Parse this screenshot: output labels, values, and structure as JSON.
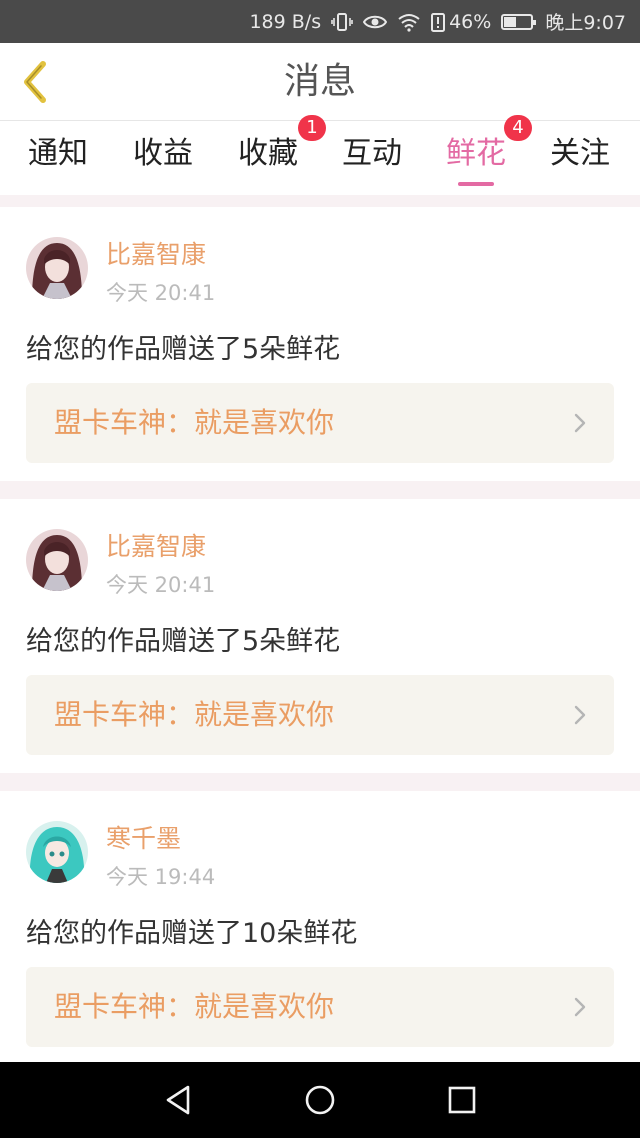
{
  "status_bar": {
    "speed": "189 B/s",
    "battery_text": "46%",
    "battery_level": 0.46,
    "time": "晚上9:07",
    "icons": [
      "vibrate-icon",
      "eye-icon",
      "wifi-icon",
      "battery-alert-icon",
      "battery-icon"
    ]
  },
  "header": {
    "title": "消息",
    "back_icon": "chevron-left-icon",
    "accent_color": "#e36aa3"
  },
  "tabs": [
    {
      "label": "通知",
      "badge": ""
    },
    {
      "label": "收益",
      "badge": ""
    },
    {
      "label": "收藏",
      "badge": "1"
    },
    {
      "label": "互动",
      "badge": ""
    },
    {
      "label": "鲜花",
      "badge": "4",
      "active": true
    },
    {
      "label": "关注",
      "badge": ""
    }
  ],
  "messages": [
    {
      "user": "比嘉智康",
      "time": "今天 20:41",
      "text": "给您的作品赠送了5朵鲜花",
      "reply": "盟卡车神：就是喜欢你",
      "avatar": "avatar-dark-hair"
    },
    {
      "user": "比嘉智康",
      "time": "今天 20:41",
      "text": "给您的作品赠送了5朵鲜花",
      "reply": "盟卡车神：就是喜欢你",
      "avatar": "avatar-dark-hair"
    },
    {
      "user": "寒千墨",
      "time": "今天 19:44",
      "text": "给您的作品赠送了10朵鲜花",
      "reply": "盟卡车神：就是喜欢你",
      "avatar": "avatar-teal-hair"
    }
  ],
  "nav_bar": {
    "buttons": [
      "back-triangle-icon",
      "home-circle-icon",
      "recents-square-icon"
    ]
  }
}
